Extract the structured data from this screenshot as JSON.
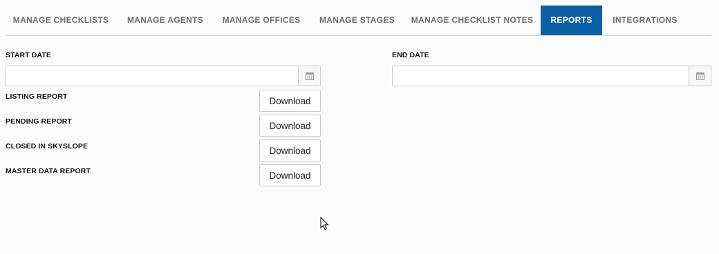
{
  "tabs": [
    {
      "label": "MANAGE CHECKLISTS",
      "active": false
    },
    {
      "label": "MANAGE AGENTS",
      "active": false
    },
    {
      "label": "MANAGE OFFICES",
      "active": false
    },
    {
      "label": "MANAGE STAGES",
      "active": false
    },
    {
      "label": "MANAGE CHECKLIST NOTES",
      "active": false
    },
    {
      "label": "REPORTS",
      "active": true
    },
    {
      "label": "INTEGRATIONS",
      "active": false
    }
  ],
  "filters": {
    "start_date": {
      "label": "START DATE",
      "value": "",
      "placeholder": ""
    },
    "end_date": {
      "label": "END DATE",
      "value": "",
      "placeholder": ""
    }
  },
  "reports": [
    {
      "label": "LISTING REPORT",
      "button": "Download"
    },
    {
      "label": "PENDING REPORT",
      "button": "Download"
    },
    {
      "label": "CLOSED IN SKYSLOPE",
      "button": "Download"
    },
    {
      "label": "MASTER DATA REPORT",
      "button": "Download"
    }
  ],
  "colors": {
    "active_tab": "#0b5fa5",
    "inactive_tab_text": "#6d6d6d",
    "background": "#fbfbfa"
  },
  "icons": {
    "calendar": "calendar-icon",
    "cursor": "mouse-pointer-icon"
  }
}
